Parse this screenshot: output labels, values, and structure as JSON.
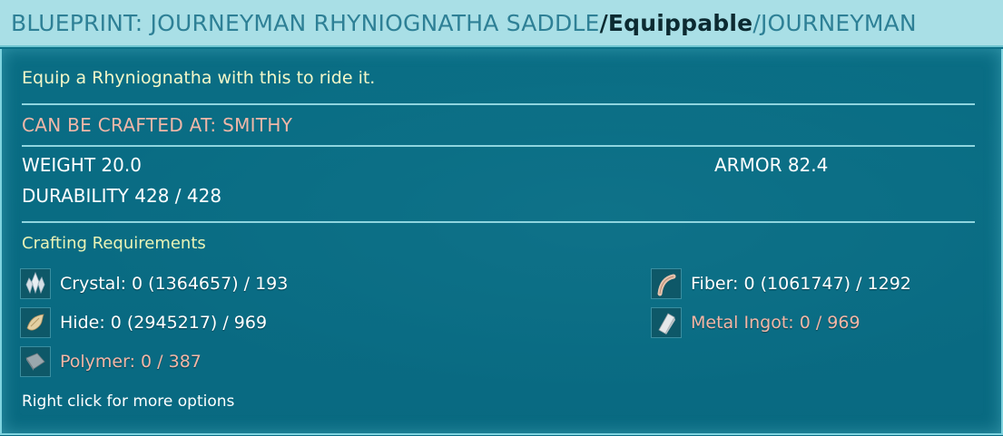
{
  "title": {
    "name": "BLUEPRINT: JOURNEYMAN RHYNIOGNATHA SADDLE",
    "sep1": " / ",
    "type": "Equippable",
    "sep2": " / ",
    "quality": "JOURNEYMAN"
  },
  "description": "Equip a Rhyniognatha with this to ride it.",
  "crafted_at": "CAN BE CRAFTED AT: SMITHY",
  "stats": {
    "weight": "WEIGHT 20.0",
    "armor": "ARMOR 82.4",
    "durability": "DURABILITY 428 / 428"
  },
  "requirements": {
    "title": "Crafting Requirements",
    "items": [
      {
        "label": "Crystal: 0 (1364657) / 193",
        "status": "ok",
        "icon": "crystal-icon"
      },
      {
        "label": "Hide: 0 (2945217) / 969",
        "status": "ok",
        "icon": "hide-icon"
      },
      {
        "label": "Polymer: 0 / 387",
        "status": "missing",
        "icon": "polymer-icon"
      },
      {
        "label": "Fiber: 0 (1061747) / 1292",
        "status": "ok",
        "icon": "fiber-icon"
      },
      {
        "label": "Metal Ingot: 0 / 969",
        "status": "missing",
        "icon": "metal-ingot-icon"
      }
    ]
  },
  "hint": "Right click for more options",
  "colors": {
    "title_bar": "#a9dfe6",
    "panel": "#0b6f87",
    "missing": "#f3b6a6",
    "ok": "#ffffff",
    "craft_at": "#f0b7a8"
  }
}
